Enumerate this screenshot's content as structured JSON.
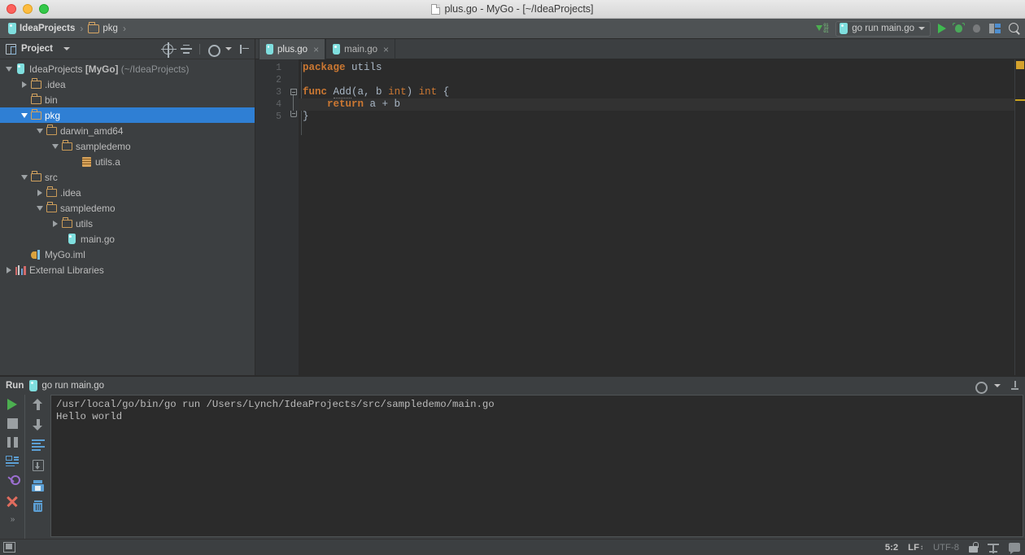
{
  "window": {
    "title": "plus.go - MyGo - [~/IdeaProjects]",
    "controls": {
      "close": "close-window",
      "minimize": "minimize-window",
      "maximize": "maximize-window"
    }
  },
  "navbar": {
    "breadcrumbs": [
      {
        "label": "IdeaProjects",
        "icon": "go-project-icon",
        "bold": true
      },
      {
        "label": "pkg",
        "icon": "folder-icon",
        "bold": false
      }
    ],
    "separator": "›",
    "actions": {
      "vcs_update": "update-project-icon",
      "run_config": "go run main.go",
      "run": "run-icon",
      "debug": "debug-icon",
      "coverage_disabled": "run-coverage-icon",
      "profile": "profiler-icon",
      "search": "search-everywhere-icon"
    }
  },
  "project_panel": {
    "title": "Project",
    "header_actions": [
      "scroll-from-source-icon",
      "collapse-all-icon",
      "settings-icon",
      "hide-icon"
    ],
    "tree": [
      {
        "label": "IdeaProjects",
        "bold_label": "[MyGo]",
        "dim": "(~/IdeaProjects)",
        "icon": "go-project-icon",
        "indent": 0,
        "twisty": "down",
        "selected": false
      },
      {
        "label": ".idea",
        "icon": "folder-icon",
        "indent": 1,
        "twisty": "right",
        "selected": false
      },
      {
        "label": "bin",
        "icon": "folder-icon",
        "indent": 1,
        "twisty": "none",
        "selected": false
      },
      {
        "label": "pkg",
        "icon": "folder-icon",
        "indent": 1,
        "twisty": "down",
        "selected": true
      },
      {
        "label": "darwin_amd64",
        "icon": "folder-icon",
        "indent": 2,
        "twisty": "down",
        "selected": false
      },
      {
        "label": "sampledemo",
        "icon": "folder-icon",
        "indent": 3,
        "twisty": "down",
        "selected": false
      },
      {
        "label": "utils.a",
        "icon": "archive-icon",
        "indent": 4,
        "twisty": "none",
        "selected": false
      },
      {
        "label": "src",
        "icon": "folder-icon",
        "indent": 1,
        "twisty": "down",
        "selected": false
      },
      {
        "label": ".idea",
        "icon": "folder-icon",
        "indent": 2,
        "twisty": "right",
        "selected": false
      },
      {
        "label": "sampledemo",
        "icon": "folder-icon",
        "indent": 2,
        "twisty": "down",
        "selected": false
      },
      {
        "label": "utils",
        "icon": "folder-icon",
        "indent": 3,
        "twisty": "right",
        "selected": false
      },
      {
        "label": "main.go",
        "icon": "go-file-icon",
        "indent": 3,
        "twisty": "none",
        "selected": false
      },
      {
        "label": "MyGo.iml",
        "icon": "iml-file-icon",
        "indent": 1,
        "twisty": "none",
        "selected": false
      },
      {
        "label": "External Libraries",
        "icon": "libraries-icon",
        "indent": 0,
        "twisty": "right",
        "selected": false
      }
    ]
  },
  "editor": {
    "tabs": [
      {
        "label": "plus.go",
        "icon": "go-file-icon",
        "active": true,
        "close": "×"
      },
      {
        "label": "main.go",
        "icon": "go-file-icon",
        "active": false,
        "close": "×"
      }
    ],
    "line_numbers": [
      "1",
      "2",
      "3",
      "4",
      "5"
    ],
    "code_lines": [
      {
        "n": 1,
        "current": false,
        "tokens": [
          {
            "t": "package",
            "c": "kw"
          },
          {
            "t": " utils",
            "c": "plain"
          }
        ]
      },
      {
        "n": 2,
        "current": false,
        "tokens": []
      },
      {
        "n": 3,
        "current": false,
        "tokens": [
          {
            "t": "func",
            "c": "kw"
          },
          {
            "t": " ",
            "c": "plain"
          },
          {
            "t": "Add",
            "c": "fn"
          },
          {
            "t": "(a, b ",
            "c": "plain"
          },
          {
            "t": "int",
            "c": "typ"
          },
          {
            "t": ") ",
            "c": "plain"
          },
          {
            "t": "int",
            "c": "typ"
          },
          {
            "t": " {",
            "c": "plain"
          }
        ]
      },
      {
        "n": 4,
        "current": true,
        "tokens": [
          {
            "t": "    ",
            "c": "plain"
          },
          {
            "t": "return",
            "c": "kw"
          },
          {
            "t": " a + b",
            "c": "plain"
          }
        ]
      },
      {
        "n": 5,
        "current": false,
        "tokens": [
          {
            "t": "}",
            "c": "plain"
          }
        ]
      }
    ],
    "markers": {
      "warning": "warning-marker",
      "inspection_color": "#d4a22d"
    }
  },
  "run_panel": {
    "label": "Run",
    "tab_label": "go run main.go",
    "tab_icon": "go-run-icon",
    "left_tools": [
      "rerun-icon",
      "stop-icon",
      "pause-icon",
      "console-view-icon",
      "pin-tab-icon",
      "close-icon",
      "expand-more-icon"
    ],
    "right_tools": [
      "scroll-up-icon",
      "scroll-down-icon",
      "soft-wrap-icon",
      "export-to-file-icon",
      "print-icon",
      "clear-all-icon"
    ],
    "header_actions": [
      "settings-icon",
      "hide-panel-icon"
    ],
    "console_lines": [
      "/usr/local/go/bin/go run /Users/Lynch/IdeaProjects/src/sampledemo/main.go",
      "Hello world"
    ]
  },
  "statusbar": {
    "layout_toggle": "toggle-tool-windows-icon",
    "caret_position": "5:2",
    "line_separator": "LF",
    "encoding": "UTF-8",
    "lock": "read-only-toggle-icon",
    "build": "build-icon",
    "notifications": "event-log-icon"
  },
  "colors": {
    "accent_selection": "#2f7fd4",
    "panel_bg": "#3c3f41",
    "editor_bg": "#2b2b2b",
    "keyword": "#cc7832",
    "text": "#a9b7c6",
    "run_green": "#4caf50",
    "warning": "#d4a22d"
  }
}
